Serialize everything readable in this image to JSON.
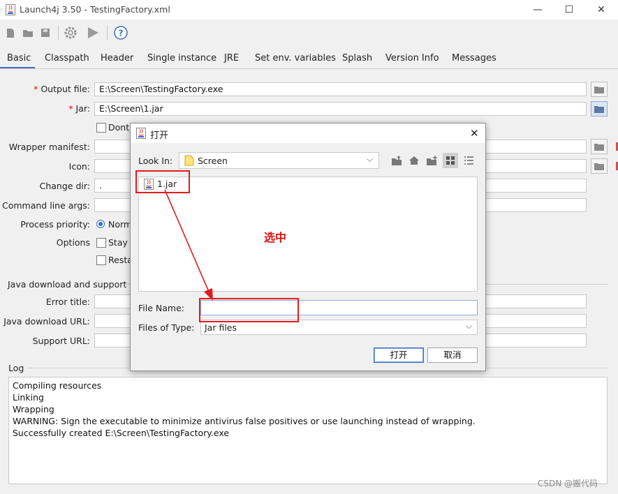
{
  "window": {
    "title": "Launch4j 3.50 - TestingFactory.xml",
    "controls": {
      "minimize": "—",
      "maximize": "☐",
      "close": "✕"
    }
  },
  "toolbar": {
    "icons": [
      "new-icon",
      "open-folder-icon",
      "save-icon",
      "gear-icon",
      "run-icon",
      "help-icon"
    ]
  },
  "tabs": [
    {
      "label": "Basic",
      "active": true
    },
    {
      "label": "Classpath"
    },
    {
      "label": "Header"
    },
    {
      "label": "Single instance"
    },
    {
      "label": "JRE"
    },
    {
      "label": "Set env. variables"
    },
    {
      "label": "Splash"
    },
    {
      "label": "Version Info"
    },
    {
      "label": "Messages"
    }
  ],
  "basic": {
    "output_file": {
      "label": "Output file:",
      "value": "E:\\Screen\\TestingFactory.exe",
      "required": "*"
    },
    "jar": {
      "label": "Jar:",
      "value": "E:\\Screen\\1.jar",
      "required": "*"
    },
    "dont_wrap_label": "Dont'",
    "wrapper_manifest_label": "Wrapper manifest:",
    "icon_label": "Icon:",
    "change_dir": {
      "label": "Change dir:",
      "value": "."
    },
    "cmd_args_label": "Command line args:",
    "process_priority": {
      "label": "Process priority:",
      "option": "Norm"
    },
    "options": {
      "label": "Options",
      "stay": "Stay a",
      "restart": "Resta"
    }
  },
  "java_download": {
    "section": "Java download and support",
    "error_title_label": "Error title:",
    "download_url_label": "Java download URL:",
    "support_url_label": "Support URL:"
  },
  "log": {
    "section": "Log",
    "lines": [
      "Compiling resources",
      "Linking",
      "Wrapping",
      "WARNING: Sign the executable to minimize antivirus false positives or use launching instead of wrapping.",
      "Successfully created E:\\Screen\\TestingFactory.exe"
    ]
  },
  "dialog": {
    "title": "打开",
    "close": "✕",
    "look_in_label": "Look In:",
    "look_in_value": "Screen",
    "files": [
      {
        "name": "1.jar"
      }
    ],
    "file_name_label": "File Name:",
    "file_name_value": "",
    "files_of_type_label": "Files of Type:",
    "files_of_type_value": "Jar files",
    "open_button": "打开",
    "cancel_button": "取消"
  },
  "annotation": {
    "text": "选中",
    "color": "#e41b1b"
  },
  "watermark": "CSDN @搬代码",
  "colors": {
    "accent": "#3a6fbf",
    "required": "#e01010",
    "annotation": "#e41b1b"
  }
}
